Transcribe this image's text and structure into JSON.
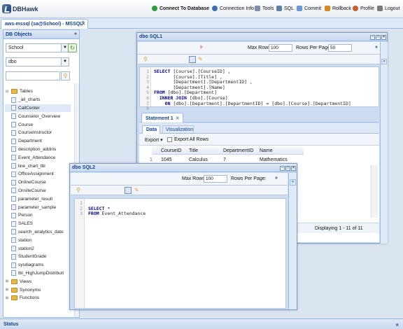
{
  "app": {
    "name": "DBHawk"
  },
  "menu": [
    {
      "label": "Connect To Database",
      "color": "#2f9a3b"
    },
    {
      "label": "Connection Info",
      "color": "#3b6fb5"
    },
    {
      "label": "Tools",
      "color": "#7d8fa8"
    },
    {
      "label": "SQL",
      "color": "#5d7fa8"
    },
    {
      "label": "Commit",
      "color": "#6b9bd2"
    },
    {
      "label": "Rollback",
      "color": "#d98a27"
    },
    {
      "label": "Profile",
      "color": "#c25f2c"
    },
    {
      "label": "Logout",
      "color": "#7a7a7a"
    }
  ],
  "main_tab": {
    "label": "aws-mssql (sa@School) - MSSQL"
  },
  "db_objects": {
    "title": "DB Objects",
    "database": "School",
    "schema": "dbo",
    "search_value": "",
    "tables_label": "Tables",
    "tables": [
      "_all_charts",
      "CallCenter",
      "Counselor_Overview",
      "Course",
      "CourseInstructor",
      "Department",
      "description_addins",
      "Event_Attendance",
      "line_chart_tbl",
      "OfficeAssignment",
      "OnlineCourse",
      "OnsiteCourse",
      "parameter_result",
      "parameter_sample",
      "Person",
      "SALES",
      "search_analytics_date",
      "station",
      "station2",
      "StudentGrade",
      "sysdiagrams",
      "tbl_HighJumpDistributi"
    ],
    "selected_table": "CallCenter",
    "folders": [
      "Views",
      "Synonyms",
      "Functions"
    ]
  },
  "sql1": {
    "title": "dbo SQL1",
    "max_rows_label": "Max Rows:",
    "max_rows": "100",
    "rows_per_page_label": "Rows Per Page:",
    "rows_per_page": "50",
    "lines": [
      "1",
      "2",
      "3",
      "4",
      "5",
      "6",
      "7",
      "8"
    ],
    "statement_tab": "Statement 1",
    "tabs": [
      "Data",
      "Visualization"
    ],
    "export_label": "Export",
    "export_all_label": "Export All Rows",
    "columns": [
      "CourseID",
      "Title",
      "DepartmentID",
      "Name"
    ],
    "rows": [
      [
        "1045",
        "Calculus",
        "7",
        "Mathematics"
      ]
    ],
    "displaying": "Displaying 1 - 11 of 11"
  },
  "sql2": {
    "title": "dbo SQL2",
    "max_rows_label": "Max Rows:",
    "max_rows": "100",
    "rows_per_page_label": "Rows Per Page:",
    "rows_per_page": "",
    "lines": [
      "1",
      "2",
      "3"
    ]
  },
  "status": {
    "label": "Status"
  }
}
